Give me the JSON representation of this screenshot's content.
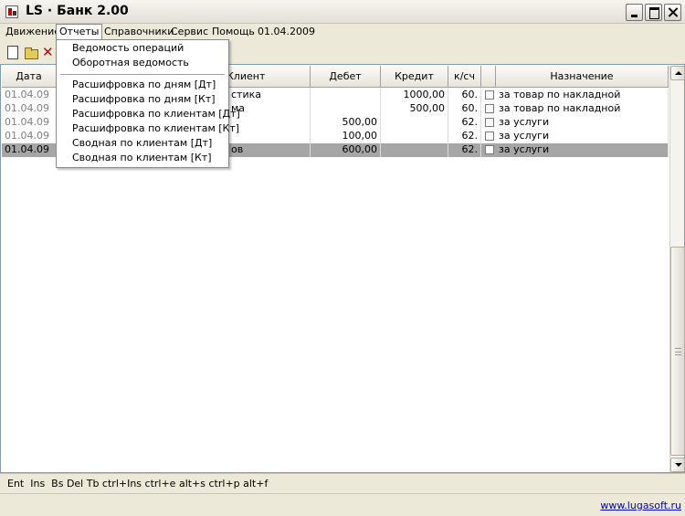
{
  "window": {
    "title": "LS · Банк 2.00"
  },
  "menu": {
    "items": [
      "Движение",
      "Отчеты",
      "Справочники",
      "Сервис",
      "Помощь"
    ],
    "date": "01.04.2009"
  },
  "dropdown": {
    "items": [
      "Ведомость операций",
      "Оборотная ведомость",
      "Расшифровка по дням [Дт]",
      "Расшифровка по дням [Кт]",
      "Расшифровка по клиентам [Дт]",
      "Расшифровка по клиентам [Кт]",
      "Сводная по клиентам [Дт]",
      "Сводная по клиентам [Кт]"
    ]
  },
  "grid": {
    "headers": [
      "Дата",
      "Клиент",
      "Дебет",
      "Кредит",
      "к/сч",
      "Назначение"
    ],
    "rows": [
      {
        "date": "01.04.09",
        "client": "стика",
        "debit": "",
        "credit": "1000,00",
        "account": "60.",
        "purpose": "за товар по накладной"
      },
      {
        "date": "01.04.09",
        "client": "ма",
        "debit": "",
        "credit": "500,00",
        "account": "60.",
        "purpose": "за товар по накладной"
      },
      {
        "date": "01.04.09",
        "client": "",
        "debit": "500,00",
        "credit": "",
        "account": "62.",
        "purpose": "за услуги"
      },
      {
        "date": "01.04.09",
        "client": "",
        "debit": "100,00",
        "credit": "",
        "account": "62.",
        "purpose": "за услуги"
      },
      {
        "date": "01.04.09",
        "client": "ов",
        "debit": "600,00",
        "credit": "",
        "account": "62.",
        "purpose": "за услуги"
      }
    ],
    "selected_row": 4
  },
  "hotkeys": "Ent  Ins  Bs Del Tb ctrl+Ins ctrl+e alt+s ctrl+p alt+f",
  "status": {
    "link": "www.lugasoft.ru"
  },
  "colors": {
    "selection": "#a6a6a6",
    "link": "#0000cc",
    "delete_icon": "#d00000"
  },
  "icons": [
    "new-file-icon",
    "open-folder-icon",
    "delete-icon",
    "chevron-up-icon",
    "chevron-down-icon"
  ]
}
